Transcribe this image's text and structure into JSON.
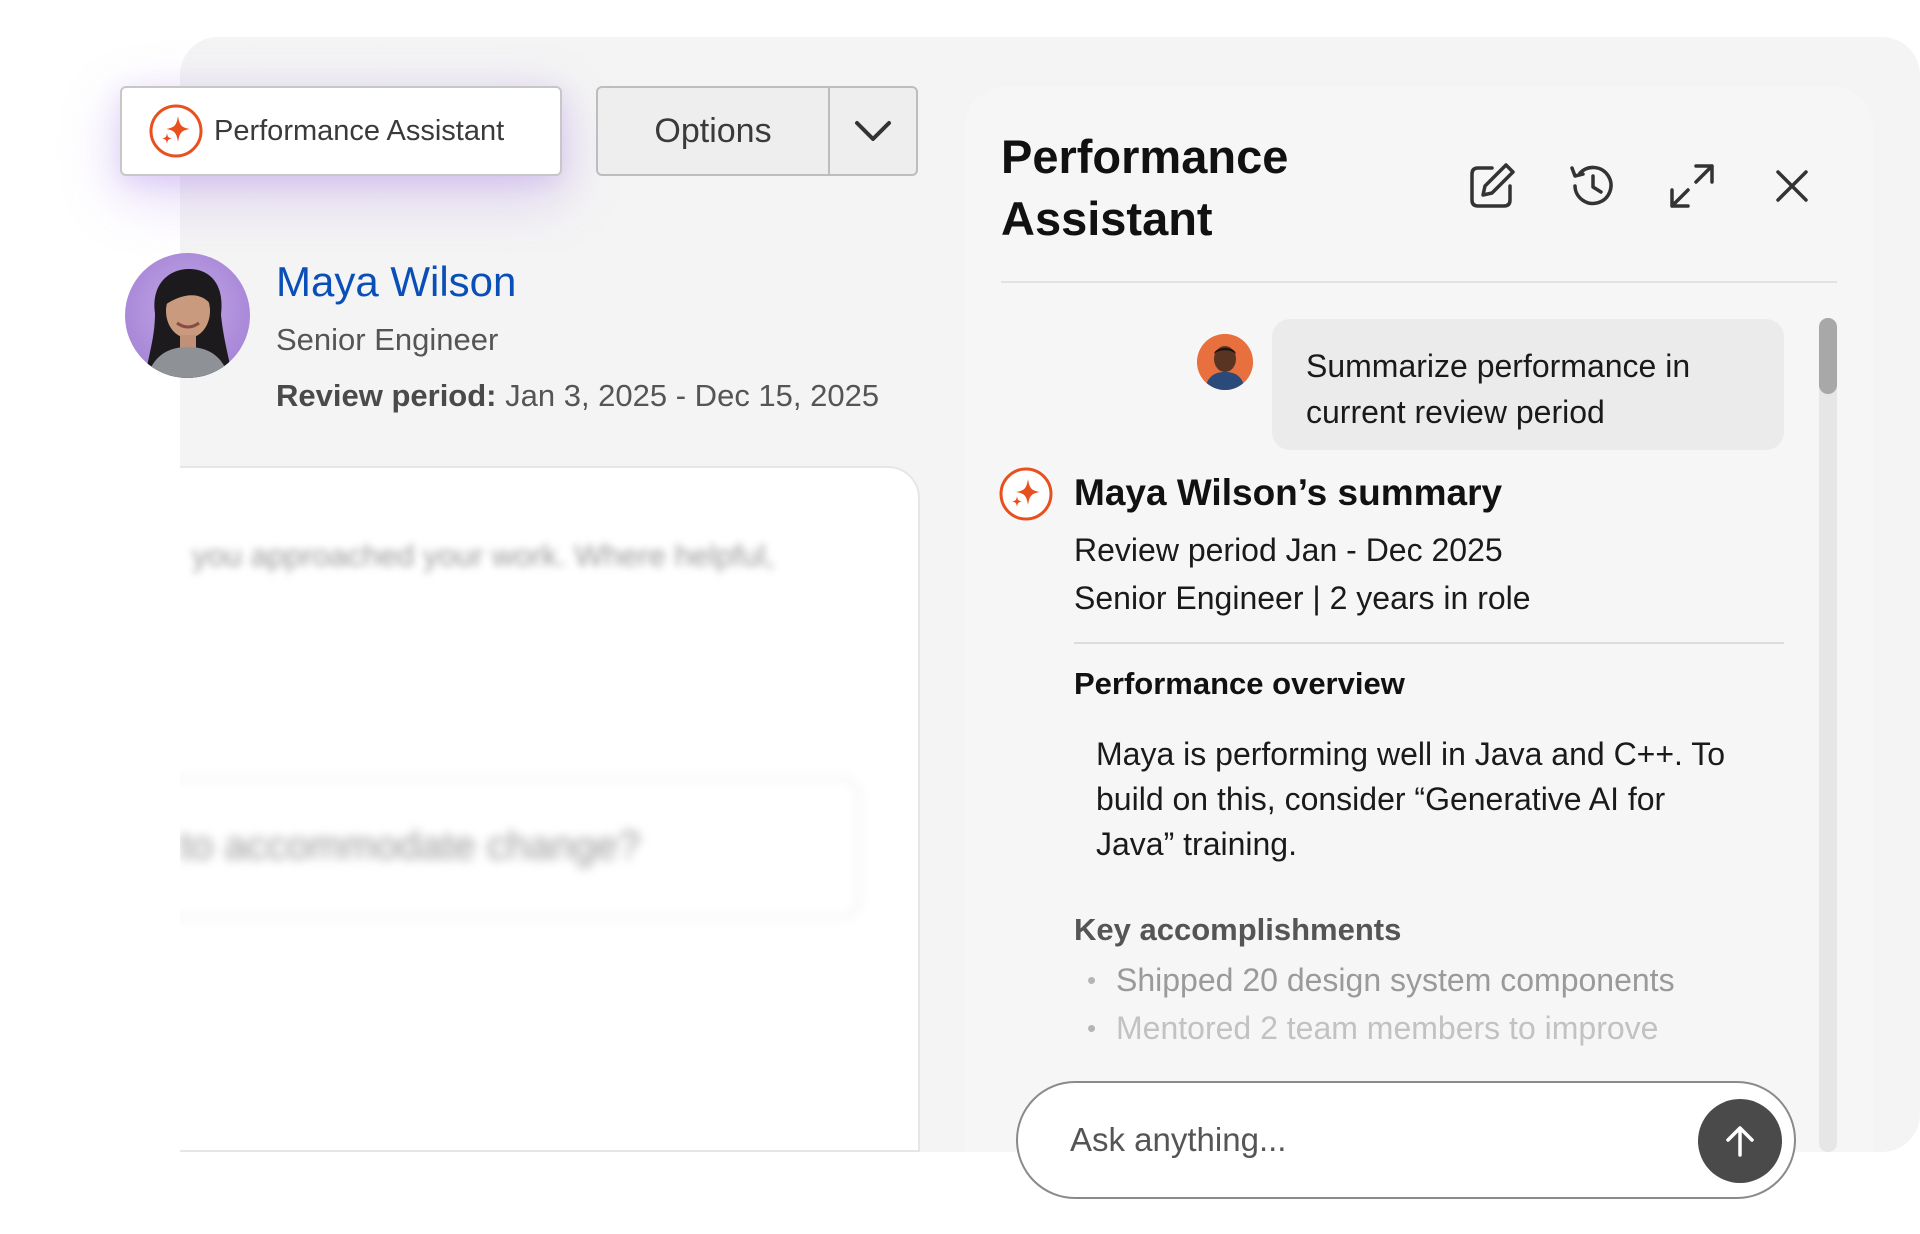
{
  "launcher": {
    "label": "Performance Assistant",
    "icon": "sparkle-icon"
  },
  "options": {
    "label": "Options",
    "icon": "chevron-down-icon"
  },
  "employee": {
    "name": "Maya Wilson",
    "title": "Senior Engineer",
    "period_label": "Review period:",
    "period_value": " Jan 3, 2025 - Dec 15, 2025"
  },
  "form": {
    "blurred_text_1": "you approached your work. Where helpful,",
    "blurred_text_2": "to accommodate change?"
  },
  "panel": {
    "title_line1": "Performance",
    "title_line2": "Assistant",
    "tools": [
      "edit-icon",
      "history-icon",
      "expand-icon",
      "close-icon"
    ],
    "user_message": "Summarize performance in current review period",
    "summary": {
      "title": "Maya Wilson’s summary",
      "period": "Review period Jan - Dec 2025",
      "role": "Senior Engineer | 2 years in role",
      "overview_heading": "Performance overview",
      "overview_body": "Maya is performing well in Java and C++. To build on this, consider “Generative AI for Java” training.",
      "accomplishments_heading": "Key accomplishments",
      "accomplishments": [
        "Shipped 20 design system components",
        "Mentored 2 team members to improve"
      ]
    }
  },
  "ask": {
    "placeholder": "Ask anything...",
    "send_icon": "arrow-up-icon"
  },
  "colors": {
    "accent": "#e8501e",
    "link": "#0a4fb8",
    "send_button": "#4a4a4a"
  }
}
